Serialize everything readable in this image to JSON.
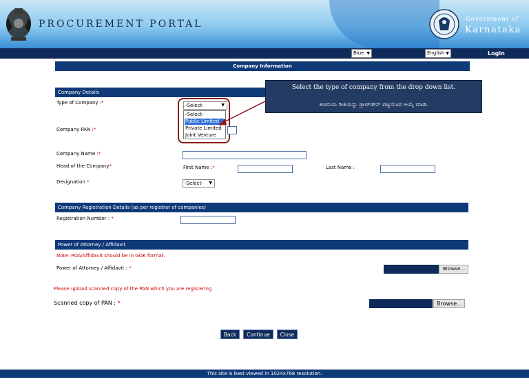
{
  "header": {
    "portal_title": "PROCUREMENT PORTAL",
    "gov_line1": "Government of",
    "gov_line2": "Karnataka"
  },
  "nav": {
    "theme_value": "Blue",
    "language_value": "English",
    "login_label": "Login"
  },
  "section_title": "Company Information",
  "company_details": {
    "header": "Company Details",
    "type_label": "Type of Company :",
    "type_select_value": "-Select-",
    "type_options": [
      "-Select-",
      "Public Limited",
      "Private Limited",
      "Joint Venture"
    ],
    "pan_label": "Company PAN :",
    "name_label": "Company Name :",
    "head_label": "Head of the Company",
    "first_name_label": "First Name :",
    "last_name_label": "Last Name :",
    "designation_label": "Designation",
    "designation_value": "-Select-",
    "required_mark": "*"
  },
  "callout": {
    "english": "Select the type of company from the drop down list.",
    "kannada": "ಕಂಪನಿಯ ರೀತಿಯನ್ನು ಡ್ರಾಪ್‌ಡೌನ್ ಪಟ್ಟಿಯಿಂದ ಆಯ್ಕೆ ಮಾಡಿ."
  },
  "registration": {
    "header": "Company Registration Details (as per registrar of companies)",
    "reg_label": "Registration Number :"
  },
  "poa": {
    "header": "Power of Attorney / Affidavit",
    "note": "Note: POA/Affidavit should be in GOK format.",
    "label": "Power of Attorney / Affidavit :",
    "browse": "Browse..."
  },
  "pan_upload": {
    "note": "Please upload scanned copy of the PAN which you are registering",
    "label": "Scanned copy of PAN :",
    "browse": "Browse..."
  },
  "buttons": {
    "back": "Back",
    "continue": "Continue",
    "close": "Close"
  },
  "footer": "This site is best viewed in 1024x768 resolution.",
  "colors": {
    "navy": "#0f2b5b",
    "section_blue": "#0f3a78",
    "required_red": "#d00000",
    "highlight_red": "#8b1a1a"
  }
}
